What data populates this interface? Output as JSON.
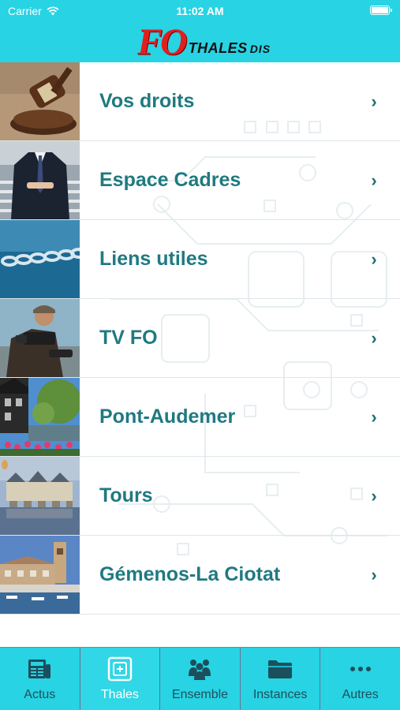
{
  "status_bar": {
    "carrier": "Carrier",
    "time": "11:02 AM"
  },
  "header": {
    "logo_fo": "FO",
    "logo_brand": "THALES",
    "logo_suffix": "DIS"
  },
  "menu": {
    "items": [
      {
        "label": "Vos droits"
      },
      {
        "label": "Espace Cadres"
      },
      {
        "label": "Liens utiles"
      },
      {
        "label": "TV FO"
      },
      {
        "label": "Pont-Audemer"
      },
      {
        "label": "Tours"
      },
      {
        "label": "Gémenos-La Ciotat"
      }
    ],
    "chevron": "›"
  },
  "tabbar": {
    "tabs": [
      {
        "label": "Actus",
        "icon": "newspaper-icon"
      },
      {
        "label": "Thales",
        "icon": "thales-icon"
      },
      {
        "label": "Ensemble",
        "icon": "group-icon"
      },
      {
        "label": "Instances",
        "icon": "folder-icon"
      },
      {
        "label": "Autres",
        "icon": "more-icon"
      }
    ],
    "active_tab": "Thales"
  },
  "colors": {
    "accent": "#28d3e3",
    "label": "#1f7a80",
    "logo_red": "#e41e1e"
  }
}
